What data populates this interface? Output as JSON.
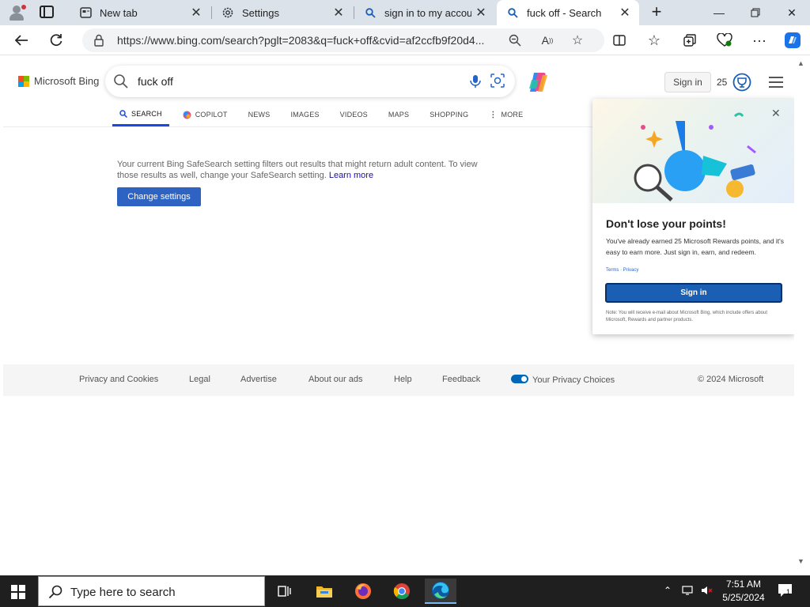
{
  "browser": {
    "tabs": [
      {
        "title": "New tab",
        "icon": "newtab-icon",
        "active": false
      },
      {
        "title": "Settings",
        "icon": "gear-icon",
        "active": false
      },
      {
        "title": "sign in to my account",
        "icon": "search-icon",
        "active": false
      },
      {
        "title": "fuck off - Search",
        "icon": "search-icon",
        "active": true
      }
    ],
    "url": "https://www.bing.com/search?pglt=2083&q=fuck+off&cvid=af2ccfb9f20d4...",
    "accent": "#0078d4"
  },
  "bing": {
    "logo_text": "Microsoft Bing",
    "query": "fuck off",
    "signin_label": "Sign in",
    "points": "25",
    "scopes": [
      {
        "label": "SEARCH",
        "icon": "search-icon",
        "active": true
      },
      {
        "label": "COPILOT",
        "icon": "copilot-icon",
        "active": false
      },
      {
        "label": "NEWS",
        "icon": "",
        "active": false
      },
      {
        "label": "IMAGES",
        "icon": "",
        "active": false
      },
      {
        "label": "VIDEOS",
        "icon": "",
        "active": false
      },
      {
        "label": "MAPS",
        "icon": "",
        "active": false
      },
      {
        "label": "SHOPPING",
        "icon": "",
        "active": false
      },
      {
        "label": "MORE",
        "icon": "more-vertical-icon",
        "active": false
      }
    ],
    "safesearch_notice": "Your current Bing SafeSearch setting filters out results that might return adult content. To view those results as well, change your SafeSearch setting.",
    "learn_more": "Learn more",
    "change_settings": "Change settings"
  },
  "flyout": {
    "title": "Don't lose your points!",
    "body": "You've already earned 25 Microsoft Rewards points, and it's easy to earn more. Just sign in, earn, and redeem.",
    "terms": "Terms · Privacy",
    "signin": "Sign in",
    "note": "Note: You will receive e-mail about Microsoft Bing, which include offers about Microsoft, Rewards and partner products."
  },
  "footer": {
    "links": [
      "Privacy and Cookies",
      "Legal",
      "Advertise",
      "About our ads",
      "Help",
      "Feedback",
      "Your Privacy Choices"
    ],
    "copyright": "© 2024 Microsoft"
  },
  "taskbar": {
    "search_placeholder": "Type here to search",
    "time": "7:51 AM",
    "date": "5/25/2024",
    "notification_count": "1",
    "apps": [
      "task-view-icon",
      "file-explorer-icon",
      "firefox-icon",
      "chrome-icon",
      "edge-icon"
    ]
  }
}
